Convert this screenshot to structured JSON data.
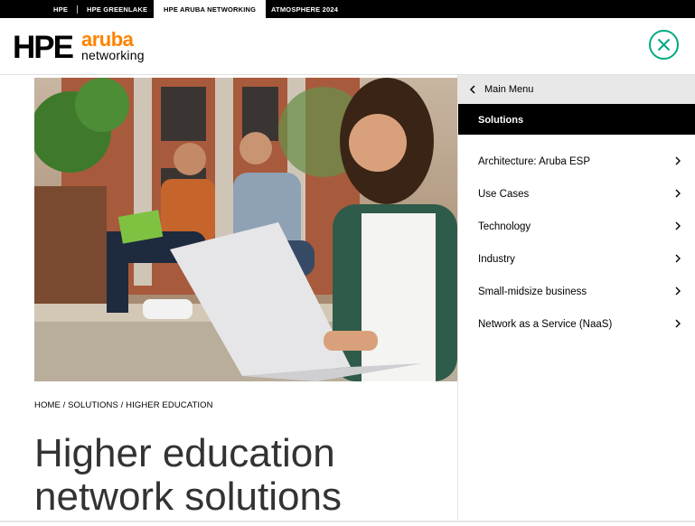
{
  "topnav": {
    "items": [
      "HPE",
      "HPE GREENLAKE",
      "HPE ARUBA NETWORKING",
      "ATMOSPHERE 2024"
    ],
    "active_index": 2
  },
  "logo": {
    "hpe": "HPE",
    "aruba": "aruba",
    "networking": "networking"
  },
  "colors": {
    "accent_green": "#01a982",
    "aruba_orange": "#ff8300",
    "black": "#000000",
    "menu_back_bg": "#e8e8e8"
  },
  "icons": {
    "close": "close-icon",
    "back": "chevron-left-icon",
    "item": "chevron-right-icon"
  },
  "breadcrumb": "HOME / SOLUTIONS / HIGHER EDUCATION",
  "title": "Higher education network solutions",
  "menu": {
    "back_label": "Main Menu",
    "section_label": "Solutions",
    "items": [
      "Architecture: Aruba ESP",
      "Use Cases",
      "Technology",
      "Industry",
      "Small-midsize business",
      "Network as a Service (NaaS)"
    ]
  }
}
